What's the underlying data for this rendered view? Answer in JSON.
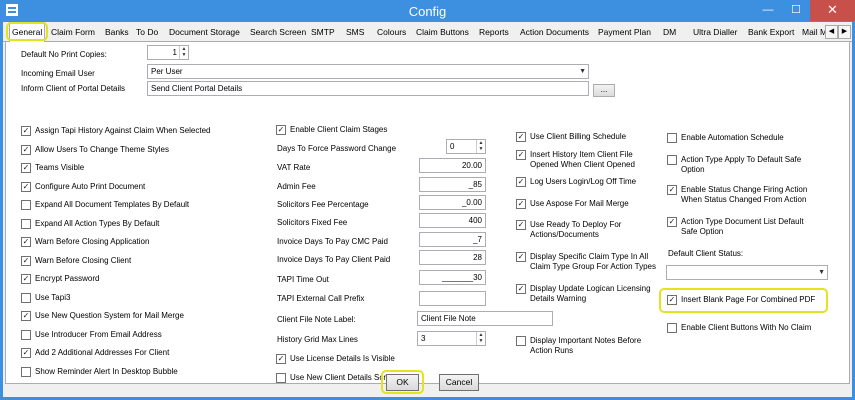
{
  "window": {
    "title": "Config",
    "min_glyph": "—",
    "max_glyph": "☐",
    "close_glyph": "✕"
  },
  "tabs": [
    "General",
    "Claim Form",
    "Banks",
    "To Do",
    "Document Storage",
    "Search Screen",
    "SMTP",
    "SMS",
    "Colours",
    "Claim Buttons",
    "Reports",
    "Action Documents",
    "Payment Plan",
    "DM",
    "Ultra Dialler",
    "Bank Export",
    "Mail M"
  ],
  "tab_scroll": {
    "left": "◀",
    "right": "▶"
  },
  "general": {
    "default_no_print_copies": {
      "label": "Default No Print Copies:",
      "value": "1"
    },
    "incoming_email_user": {
      "label": "Incoming Email User",
      "value": "Per User"
    },
    "inform_client": {
      "label": "Inform Client of Portal Details",
      "value": "Send Client Portal Details",
      "button": "..."
    }
  },
  "col1": [
    {
      "label": "Assign Tapi History Against Claim When Selected",
      "checked": true
    },
    {
      "label": "Allow Users To Change Theme Styles",
      "checked": true
    },
    {
      "label": "Teams Visible",
      "checked": true
    },
    {
      "label": "Configure Auto Print Document",
      "checked": true
    },
    {
      "label": "Expand All Document Templates By Default",
      "checked": false
    },
    {
      "label": "Expand All Action Types By Default",
      "checked": false
    },
    {
      "label": "Warn Before Closing Application",
      "checked": true
    },
    {
      "label": "Warn Before Closing Client",
      "checked": true
    },
    {
      "label": "Encrypt Password",
      "checked": true
    },
    {
      "label": "Use Tapi3",
      "checked": false
    },
    {
      "label": "Use New Question System for Mail Merge",
      "checked": true
    },
    {
      "label": "Use Introducer From Email Address",
      "checked": false
    },
    {
      "label": "Add 2 Additional Addresses For Client",
      "checked": true
    },
    {
      "label": "Show Reminder Alert In Desktop Bubble",
      "checked": false
    }
  ],
  "col2": {
    "enable_client_claim_stages": {
      "label": "Enable Client Claim Stages",
      "checked": true
    },
    "fields": [
      {
        "label": "Days To Force Password Change",
        "value": "0"
      },
      {
        "label": "VAT Rate",
        "value": "20.00"
      },
      {
        "label": "Admin Fee",
        "value": "_85"
      },
      {
        "label": "Solicitors Fee Percentage",
        "value": "_0.00"
      },
      {
        "label": "Solicitors Fixed Fee",
        "value": "400"
      },
      {
        "label": "Invoice Days To Pay CMC Paid",
        "value": "_7"
      },
      {
        "label": "Invoice Days To Pay Client Paid",
        "value": "28"
      },
      {
        "label": "TAPI Time Out",
        "value": "_______30"
      },
      {
        "label": "TAPI External Call Prefix",
        "value": ""
      }
    ],
    "client_file_note": {
      "label": "Client File Note Label:",
      "value": "Client File Note"
    },
    "history_grid": {
      "label": "History Grid Max Lines",
      "value": "3"
    },
    "use_license_details": {
      "label": "Use License Details Is Visible",
      "checked": true
    },
    "use_new_client_details": {
      "label": "Use New Client Details Screen",
      "checked": false
    }
  },
  "col3": [
    {
      "label": "Use Client Billing Schedule",
      "checked": true
    },
    {
      "label": "Insert History Item Client File Opened When Client Opened",
      "checked": true
    },
    {
      "label": "Log Users Login/Log Off Time",
      "checked": true
    },
    {
      "label": "Use Aspose For Mail Merge",
      "checked": true
    },
    {
      "label": "Use Ready To Deploy For Actions/Documents",
      "checked": true
    },
    {
      "label": "Display Specific Claim Type In All Claim Type Group For Action Types",
      "checked": true
    },
    {
      "label": "Display Update Logican Licensing Details Warning",
      "checked": true
    },
    {
      "label": "Display Important Notes Before Action Runs",
      "checked": false
    }
  ],
  "col4": [
    {
      "label": "Enable Automation Schedule",
      "checked": false
    },
    {
      "label": "Action Type Apply To Default Safe Option",
      "checked": false
    },
    {
      "label": "Enable Status Change Firing Action When Status Changed From Action",
      "checked": true
    },
    {
      "label": "Action Type Document List Default Safe Option",
      "checked": true
    }
  ],
  "default_client_status": {
    "label": "Default Client Status:",
    "value": ""
  },
  "insert_blank_page": {
    "label": "Insert Blank Page For Combined PDF",
    "checked": true
  },
  "enable_client_buttons": {
    "label": "Enable Client Buttons With No Claim",
    "checked": false
  },
  "footer": {
    "ok": "OK",
    "cancel": "Cancel"
  },
  "colors": {
    "title_bar": "#3d8fe0",
    "close": "#c7504b",
    "highlight": "#e3e31f"
  }
}
